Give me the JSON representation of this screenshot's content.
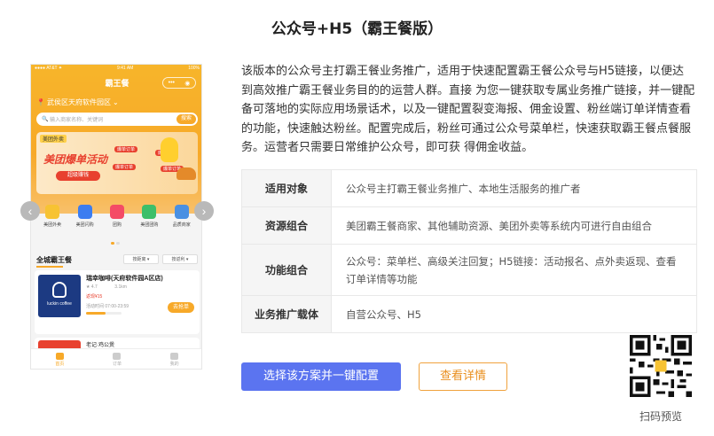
{
  "title": "公众号+H5（霸王餐版）",
  "phone": {
    "status_left": "●●●● AT&T ✦",
    "status_time": "9:41 AM",
    "status_right": "100%",
    "header_title": "霸王餐",
    "capsule_more": "•••",
    "capsule_close": "◉",
    "location": "武侯区天府软件园区",
    "search_placeholder": "输入商家名称、关键词",
    "search_button": "搜索",
    "banner": {
      "tag": "美团外卖",
      "headline": "美团爆单活动",
      "button": "超级赚钱",
      "chips": [
        "爆单订单",
        "爆单订单",
        "爆单订单",
        "爆单订单"
      ]
    },
    "categories": [
      {
        "label": "美团外卖",
        "color": "#f7c333"
      },
      {
        "label": "美团闪购",
        "color": "#3c7df0"
      },
      {
        "label": "团购",
        "color": "#f44b66"
      },
      {
        "label": "美团团购",
        "color": "#3cbf6a"
      },
      {
        "label": "品质商家",
        "color": "#4a90e2"
      }
    ],
    "section_title": "全城霸王餐",
    "filter_distance": "按距离 ▾",
    "filter_sort": "按返利 ▾",
    "card": {
      "name": "瑞幸咖啡(天府软件园A区店)",
      "rating": "★ 4.7",
      "distance": "3.1km",
      "rebate": "返现¥15",
      "time": "活动时间 07:00-23:59",
      "progress": 0.55,
      "progress_label": "已抢",
      "grab_button": "去抢单",
      "brand": "luckin coffee"
    },
    "card2_name": "老记·鸡公煲",
    "tabs": [
      {
        "label": "首页",
        "active": true
      },
      {
        "label": "订单",
        "active": false
      },
      {
        "label": "我的",
        "active": false
      }
    ],
    "arrow_left": "‹",
    "arrow_right": "›"
  },
  "description": "该版本的公众号主打霸王餐业务推广，适用于快速配置霸王餐公众号与H5链接，以便达到高效推广霸王餐业务目的的运营人群。直接 为您一键获取专属业务推广链接，并一键配备可落地的实际应用场景话术，以及一键配置裂变海报、佣金设置、粉丝端订单详情查看 的功能，快速触达粉丝。配置完成后，粉丝可通过公众号菜单栏，快速获取霸王餐点餐服务。运营者只需要日常维护公众号，即可获 得佣金收益。",
  "table": [
    {
      "key": "适用对象",
      "value": "公众号主打霸王餐业务推广、本地生活服务的推广者"
    },
    {
      "key": "资源组合",
      "value": "美团霸王餐商家、其他辅助资源、美团外卖等系统内可进行自由组合"
    },
    {
      "key": "功能组合",
      "value": "公众号：菜单栏、高级关注回复；H5链接：活动报名、点外卖返现、查看订单详情等功能"
    },
    {
      "key": "业务推广载体",
      "value": "自营公众号、H5"
    }
  ],
  "buttons": {
    "primary": "选择该方案并一键配置",
    "secondary": "查看详情"
  },
  "qr_label": "扫码预览",
  "colors": {
    "accent_blue": "#5b74f0",
    "accent_orange": "#f0a23d",
    "phone_yellow": "#f7a929"
  }
}
